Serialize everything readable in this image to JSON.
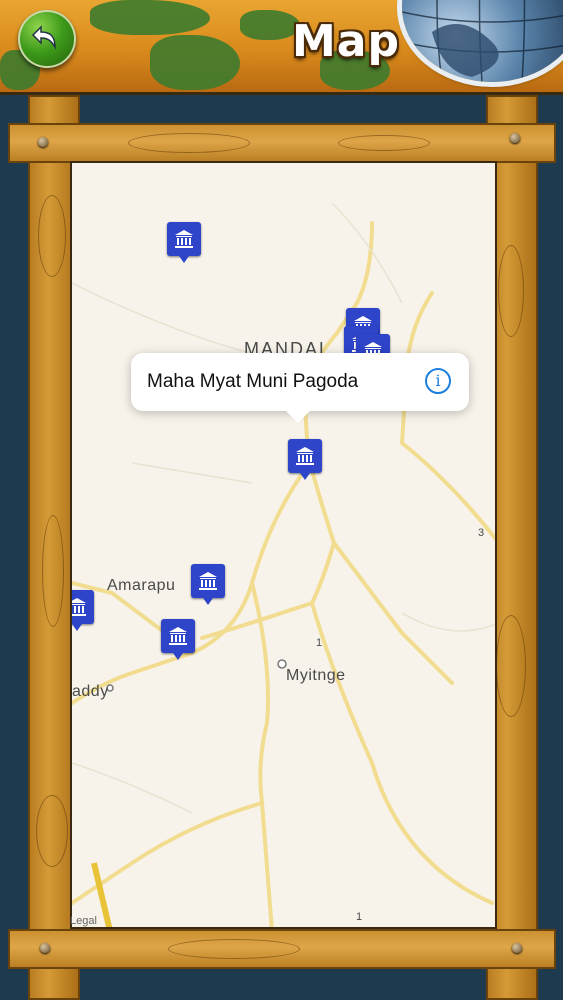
{
  "header": {
    "title": "Map",
    "back_icon": "back-arrow-icon"
  },
  "map": {
    "places": {
      "mandalay": "MANDAL",
      "amarapura": "Amarapu",
      "myitnge": "Myitnge",
      "paddy": "addy"
    },
    "road_numbers": [
      "3",
      "1",
      "1"
    ],
    "callout": {
      "title": "Maha Myat Muni Pagoda",
      "info": "i"
    },
    "legal": "Legal",
    "pin_color": "#2e44c9"
  }
}
